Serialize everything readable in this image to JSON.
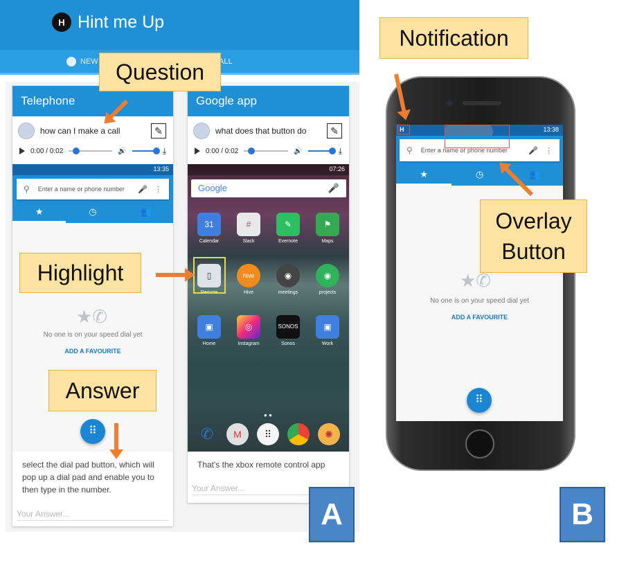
{
  "app": {
    "title": "Hint me Up",
    "logo": "H",
    "tabs": [
      "NEW",
      "ALL"
    ]
  },
  "cards": [
    {
      "title": "Telephone",
      "question": "how can I make a call",
      "audio_time": "0:00 / 0:02",
      "screen": {
        "time": "13:35",
        "search_placeholder": "Enter a name or phone number",
        "empty_text": "No one is on your speed dial yet",
        "empty_link": "ADD A FAVOURITE"
      },
      "answer": "select the dial pad button, which will pop up a dial pad and enable you to then type in the number.",
      "answer_placeholder": "Your Answer..."
    },
    {
      "title": "Google app",
      "question": "what does that button do",
      "audio_time": "0:00 / 0:02",
      "screen": {
        "time": "07:26",
        "search_brand": "Google",
        "apps": [
          "Calendar",
          "Slack",
          "Evernote",
          "Maps",
          "Remote",
          "Hive",
          "meetings",
          "projects",
          "Home",
          "Instagram",
          "Sonos",
          "Work"
        ]
      },
      "answer": "That's the xbox remote control app",
      "answer_placeholder": "Your Answer..."
    }
  ],
  "phone_b": {
    "time": "13:38",
    "search_placeholder": "Enter a name or phone number",
    "empty_text": "No one is on your speed dial yet",
    "empty_link": "ADD A FAVOURITE"
  },
  "callouts": {
    "question": "Question",
    "highlight": "Highlight",
    "answer": "Answer",
    "notification": "Notification",
    "overlay_button": "Overlay Button"
  },
  "panel_labels": {
    "a": "A",
    "b": "B"
  },
  "colors": {
    "primary": "#1f8fd6",
    "callout_fill": "#fde2a1",
    "arrow": "#ed7d31",
    "panel_label": "#4a86c7"
  }
}
